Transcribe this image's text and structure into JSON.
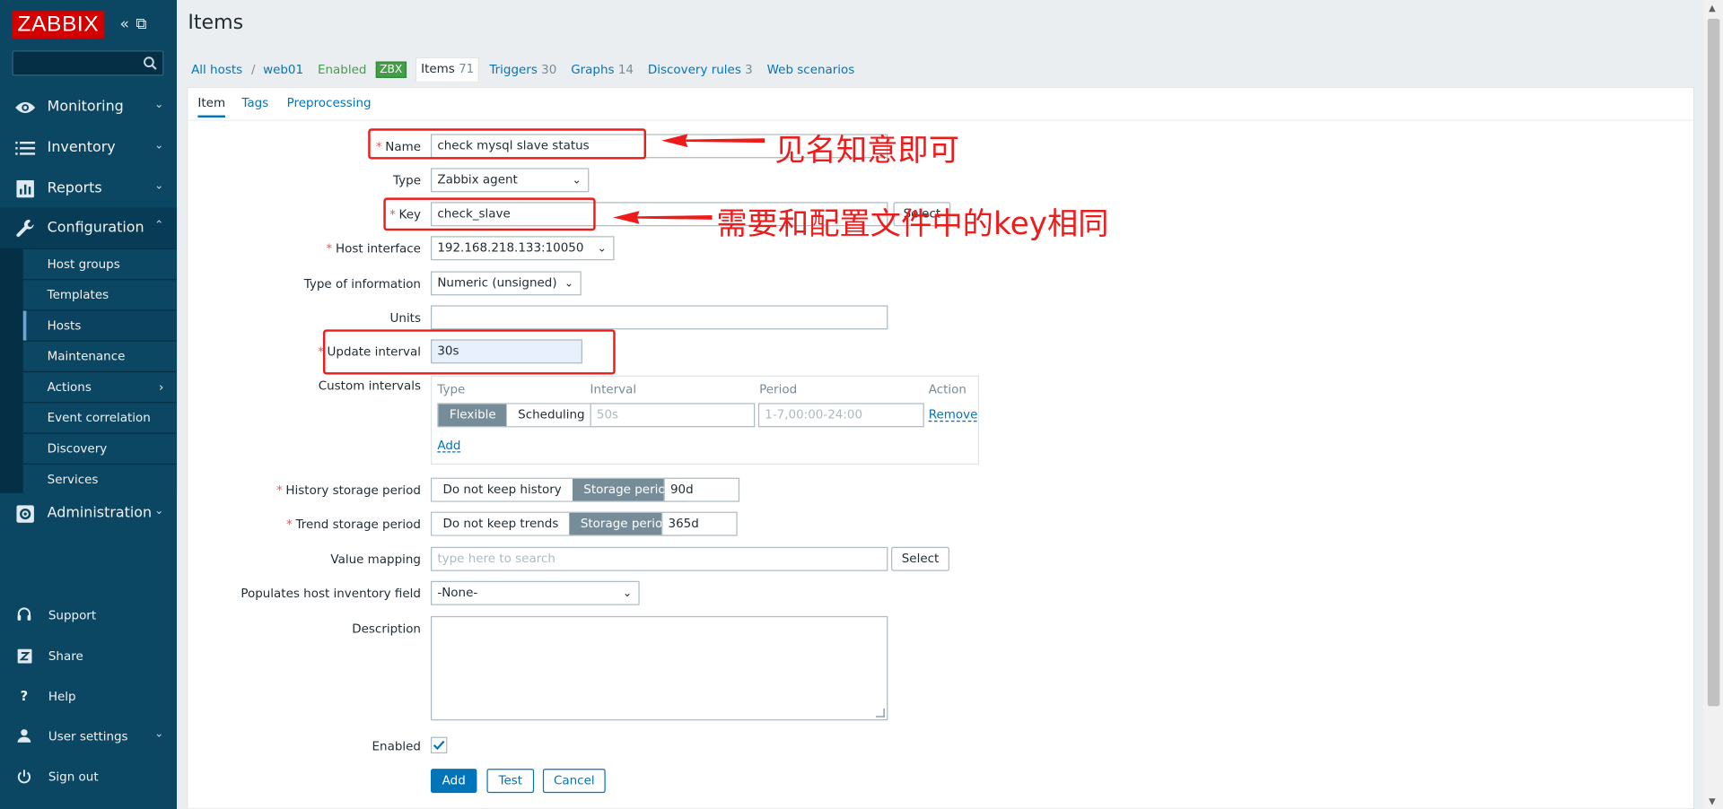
{
  "colors": {
    "sidebar": "#0b4663",
    "brand": "#d40000",
    "link": "#0275b8",
    "annotation": "#ee1b1b",
    "enabled": "#429e47"
  },
  "logo": "ZABBIX",
  "sidebar": {
    "search_placeholder": "",
    "menu": [
      {
        "label": "Monitoring",
        "icon": "eye-icon"
      },
      {
        "label": "Inventory",
        "icon": "list-icon"
      },
      {
        "label": "Reports",
        "icon": "bar-chart-icon"
      },
      {
        "label": "Configuration",
        "icon": "wrench-icon"
      },
      {
        "label": "Administration",
        "icon": "gear-icon"
      }
    ],
    "config_submenu": [
      "Host groups",
      "Templates",
      "Hosts",
      "Maintenance",
      "Actions",
      "Event correlation",
      "Discovery",
      "Services"
    ],
    "footer": [
      {
        "label": "Support",
        "icon": "headset-icon"
      },
      {
        "label": "Share",
        "icon": "share-z-icon"
      },
      {
        "label": "Help",
        "icon": "question-icon"
      },
      {
        "label": "User settings",
        "icon": "user-icon"
      },
      {
        "label": "Sign out",
        "icon": "power-icon"
      }
    ]
  },
  "page": {
    "title": "Items"
  },
  "host_nav": {
    "all_hosts": "All hosts",
    "separator": "/",
    "host": "web01",
    "status": "Enabled",
    "badge": "ZBX",
    "items_label": "Items",
    "items_count": "71",
    "triggers_label": "Triggers",
    "triggers_count": "30",
    "graphs_label": "Graphs",
    "graphs_count": "14",
    "discovery_label": "Discovery rules",
    "discovery_count": "3",
    "web_label": "Web scenarios"
  },
  "tabs": [
    "Item",
    "Tags",
    "Preprocessing"
  ],
  "form": {
    "required_mark": "*",
    "name_label": "Name",
    "name_value": "check  mysql  slave status",
    "type_label": "Type",
    "type_value": "Zabbix agent",
    "key_label": "Key",
    "key_value": "check_slave",
    "key_select": "Select",
    "interface_label": "Host interface",
    "interface_value": "192.168.218.133:10050",
    "info_type_label": "Type of information",
    "info_type_value": "Numeric (unsigned)",
    "units_label": "Units",
    "units_value": "",
    "interval_label": "Update interval",
    "interval_value": "30s",
    "custom_label": "Custom intervals",
    "custom": {
      "col_type": "Type",
      "col_interval": "Interval",
      "col_period": "Period",
      "col_action": "Action",
      "flexible": "Flexible",
      "scheduling": "Scheduling",
      "interval_placeholder": "50s",
      "period_placeholder": "1-7,00:00-24:00",
      "remove": "Remove",
      "add": "Add"
    },
    "history_label": "History storage period",
    "history_off": "Do not keep history",
    "history_on": "Storage period",
    "history_value": "90d",
    "trend_label": "Trend storage period",
    "trend_off": "Do not keep trends",
    "trend_on": "Storage period",
    "trend_value": "365d",
    "mapping_label": "Value mapping",
    "mapping_placeholder": "type here to search",
    "mapping_select": "Select",
    "inventory_label": "Populates host inventory field",
    "inventory_value": "-None-",
    "description_label": "Description",
    "enabled_label": "Enabled",
    "enabled_checked": true,
    "buttons": {
      "add": "Add",
      "test": "Test",
      "cancel": "Cancel"
    }
  },
  "annotations": {
    "name_note": "见名知意即可",
    "key_note": "需要和配置文件中的key相同"
  }
}
